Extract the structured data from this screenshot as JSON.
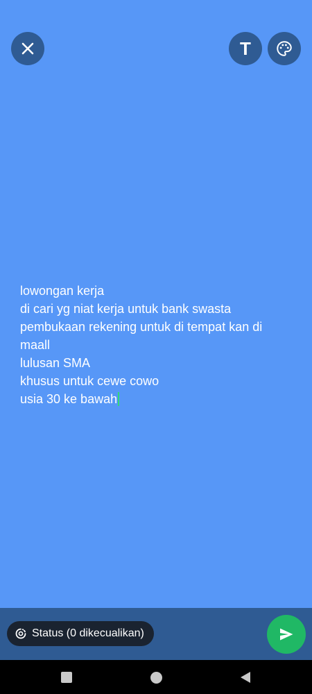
{
  "colors": {
    "background": "#5797f7",
    "button_bg": "#2f5b93",
    "send_accent": "#20b865",
    "caret": "#32d87a"
  },
  "top_actions": {
    "close_icon": "close-icon",
    "text_style_glyph": "T",
    "palette_icon": "palette-icon"
  },
  "status_text": {
    "lines": [
      "lowongan kerja",
      "di cari yg niat kerja untuk bank swasta",
      "pembukaan rekening untuk di tempat kan di",
      "maall",
      "lulusan SMA",
      "khusus untuk cewe cowo",
      "usia 30 ke bawah"
    ]
  },
  "bottom_bar": {
    "audience_icon": "status-ring-icon",
    "audience_label": "Status (0 dikecualikan)",
    "send_icon": "send-icon"
  },
  "nav_bar": {
    "recents_icon": "recents-icon",
    "home_icon": "home-icon",
    "back_icon": "back-icon"
  }
}
